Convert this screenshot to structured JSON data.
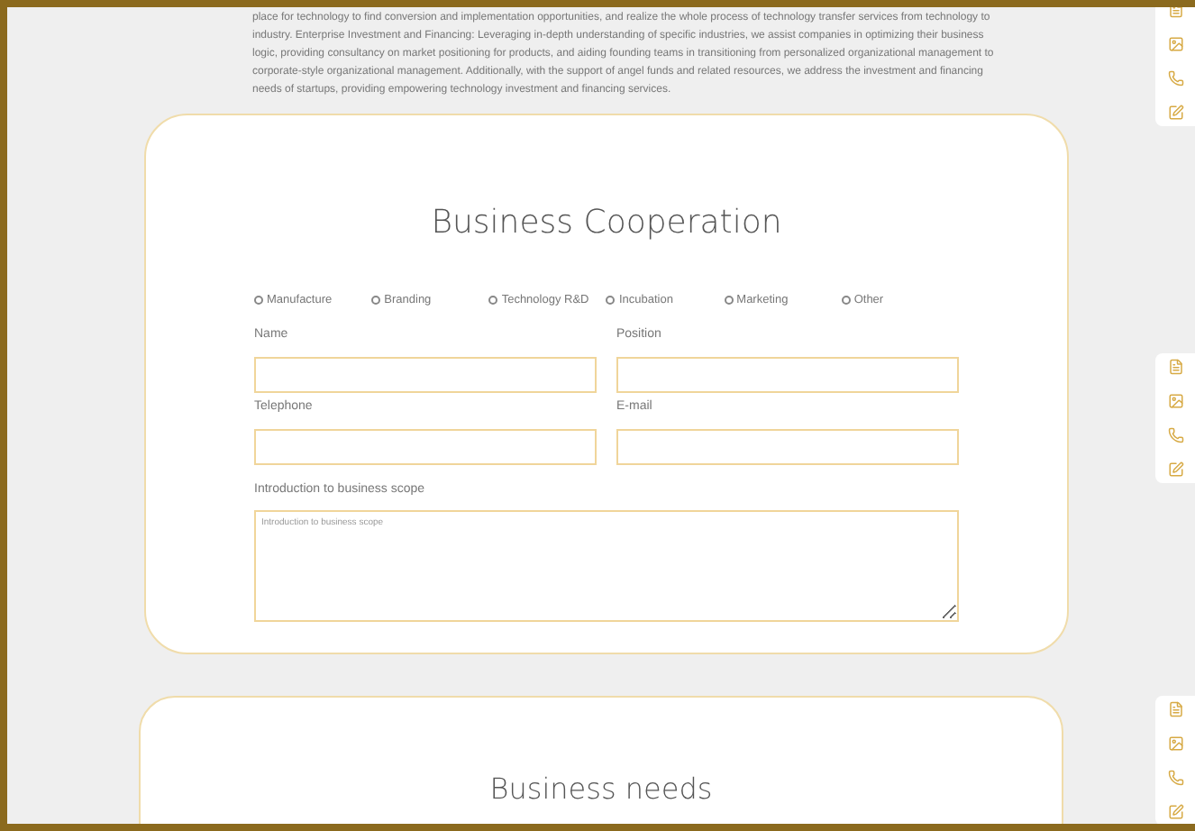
{
  "intro": {
    "text": "place for technology to find conversion and implementation opportunities, and realize the whole process of technology transfer services from technology to industry. Enterprise Investment and Financing: Leveraging in-depth understanding of specific industries, we assist companies in optimizing their business logic, providing consultancy on market positioning for products, and aiding founding teams in transitioning from personalized organizational management to corporate-style organizational management. Additionally, with the support of angel funds and related resources, we address the investment and financing needs of startups, providing empowering technology investment and financing services."
  },
  "cooperation": {
    "title": "Business Cooperation",
    "options": [
      {
        "label": "Manufacture",
        "selected": false
      },
      {
        "label": "Branding",
        "selected": false
      },
      {
        "label": "Technology R&D",
        "selected": false
      },
      {
        "label": "Incubation",
        "selected": false
      },
      {
        "label": "Marketing",
        "selected": false
      },
      {
        "label": "Other",
        "selected": false
      }
    ],
    "fields": [
      {
        "label": "Name"
      },
      {
        "label": "Position"
      },
      {
        "label": "Telephone"
      },
      {
        "label": "E-mail"
      }
    ],
    "scope": {
      "label": "Introduction to business scope",
      "placeholder": "Introduction to business scope"
    }
  },
  "needs": {
    "title": "Business needs"
  }
}
